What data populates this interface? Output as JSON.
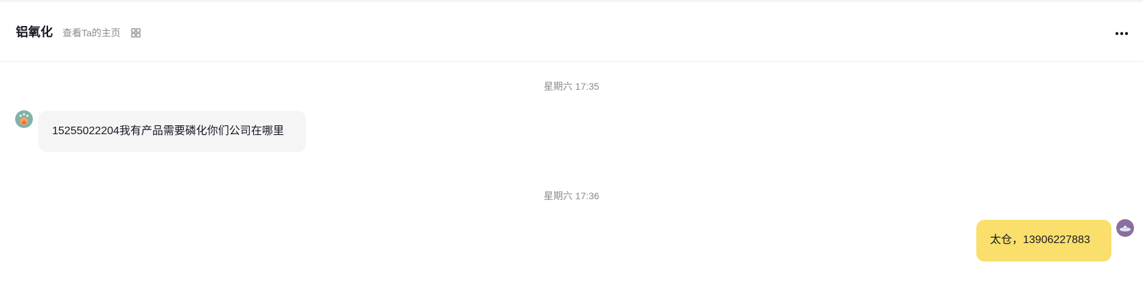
{
  "header": {
    "contact_name": "铝氧化",
    "profile_link": "查看Ta的主页",
    "qr_icon": "qr-code-icon",
    "more_icon": "more-dots-icon"
  },
  "messages": [
    {
      "timestamp": "星期六 17:35",
      "direction": "incoming",
      "text": "15255022204我有产品需要磷化你们公司在哪里"
    },
    {
      "timestamp": "星期六 17:36",
      "direction": "outgoing",
      "text": "太仓，13906227883"
    }
  ],
  "colors": {
    "incoming_bubble": "#f5f5f5",
    "outgoing_bubble": "#fbdf6c",
    "timestamp_text": "#8a8b91"
  }
}
